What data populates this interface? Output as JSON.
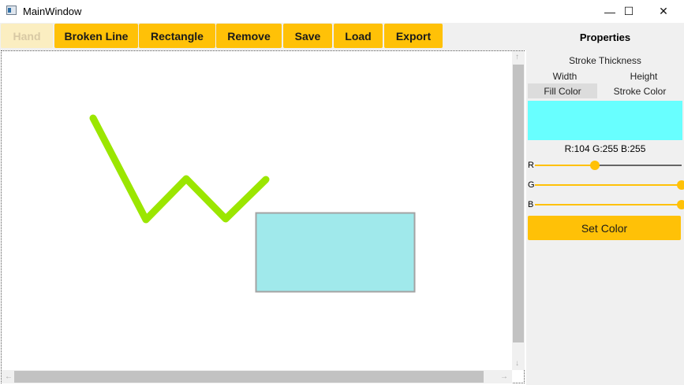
{
  "window": {
    "title": "MainWindow",
    "minimize_glyph": "—",
    "maximize_glyph": "☐",
    "close_glyph": "✕"
  },
  "toolbar": {
    "buttons": [
      {
        "label": "Hand",
        "active": true
      },
      {
        "label": "Broken Line"
      },
      {
        "label": "Rectangle"
      },
      {
        "label": "Remove"
      },
      {
        "label": "Save"
      },
      {
        "label": "Load"
      },
      {
        "label": "Export"
      }
    ]
  },
  "canvas": {
    "broken_line_color": "#9be600",
    "rectangle": {
      "fill": "#a0e9eb",
      "stroke": "#a3a3a3"
    }
  },
  "properties": {
    "title": "Properties",
    "stroke_thickness_label": "Stroke Thickness",
    "width_label": "Width",
    "height_label": "Height",
    "tabs": [
      "Fill Color",
      "Stroke Color"
    ],
    "selected_tab": "Fill Color",
    "preview_color": "#68ffff",
    "rgb_text": "R:104 G:255 B:255",
    "sliders": [
      {
        "label": "R",
        "value": 104
      },
      {
        "label": "G",
        "value": 255
      },
      {
        "label": "B",
        "value": 255
      }
    ],
    "set_color_label": "Set Color"
  },
  "colors": {
    "accent": "#ffc107",
    "accent_inactive": "#fbeec1"
  }
}
